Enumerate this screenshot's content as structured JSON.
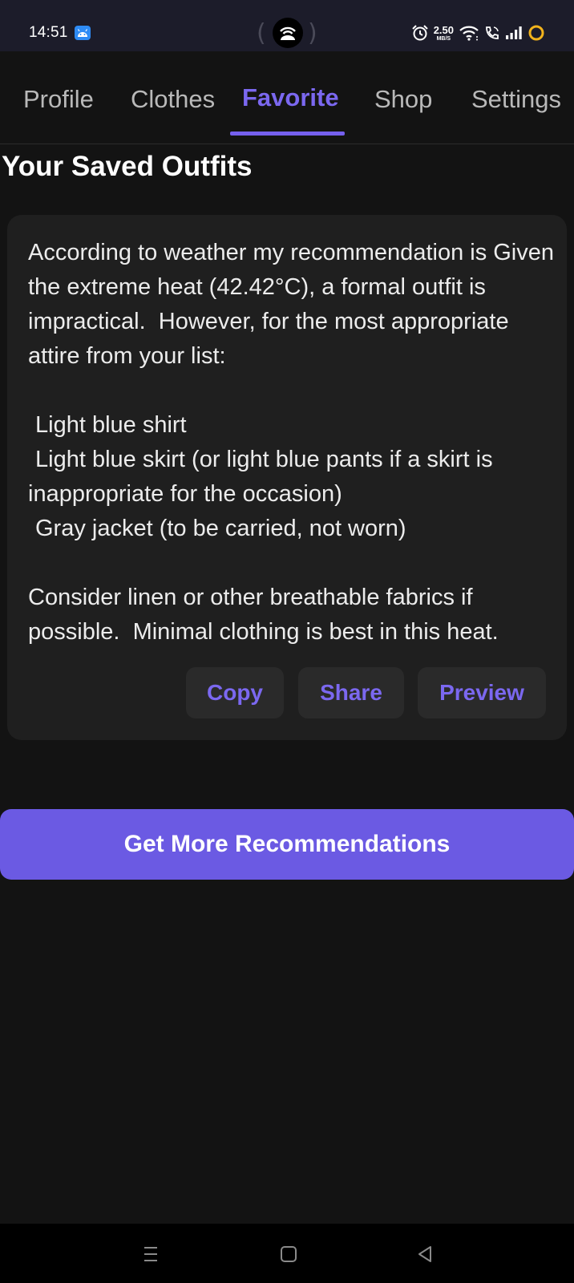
{
  "status_bar": {
    "time": "14:51",
    "net_speed_value": "2.50",
    "net_speed_unit": "MB/S",
    "icons": [
      "android-badge-icon",
      "alarm-icon",
      "wifi-icon",
      "wifi-calling-icon",
      "signal-icon",
      "battery-ring-icon"
    ]
  },
  "tabs": [
    {
      "label": "Profile",
      "active": false
    },
    {
      "label": "Clothes",
      "active": false
    },
    {
      "label": "Favorite",
      "active": true
    },
    {
      "label": "Shop",
      "active": false
    },
    {
      "label": "Settings",
      "active": false
    }
  ],
  "page_title": "Your Saved Outfits",
  "outfit_card": {
    "intro": "According to weather my recommendation is Given the extreme heat (42.42°C), a formal outfit is impractical.  However, for the most appropriate attire from your list:",
    "items": [
      "Light blue shirt",
      "Light blue skirt (or light blue pants if a skirt is inappropriate for the occasion)",
      "Gray jacket (to be carried, not worn)"
    ],
    "closing": "Consider linen or other breathable fabrics if possible.  Minimal clothing is best in this heat.",
    "actions": {
      "copy": "Copy",
      "share": "Share",
      "preview": "Preview"
    }
  },
  "cta_label": "Get More Recommendations",
  "nav_bar": {
    "icons": [
      "recents-icon",
      "home-icon",
      "back-icon"
    ]
  },
  "colors": {
    "accent": "#7b68f0",
    "cta_background": "#6b5ae3",
    "background": "#131313",
    "card": "#1f1f1f"
  }
}
